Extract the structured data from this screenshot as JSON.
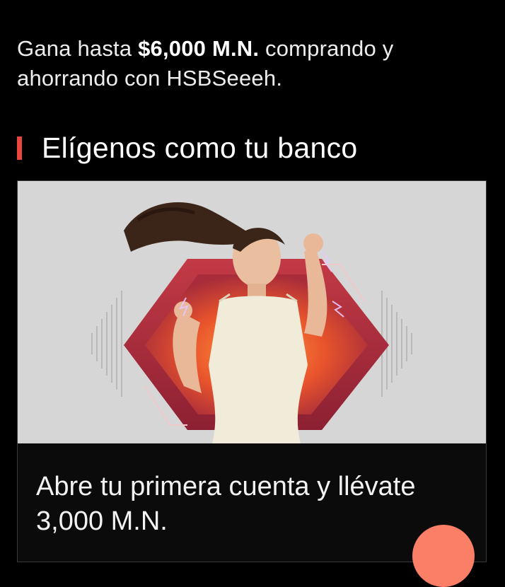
{
  "promo": {
    "prefix": "Gana hasta ",
    "amount": "$6,000 M.N.",
    "suffix": " comprando y ahorrando con HSBSeeeh."
  },
  "section": {
    "title": "Elígenos como tu banco"
  },
  "card": {
    "image_alt": "woman-dancing-hexagon-banner",
    "headline": "Abre tu primera cuenta y llévate 3,000 M.N."
  },
  "colors": {
    "accent": "#e9463f",
    "fab": "#fb7e66",
    "background": "#000000"
  }
}
